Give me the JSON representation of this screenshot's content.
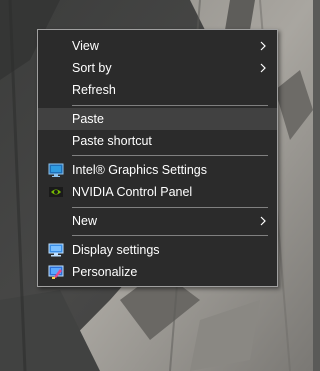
{
  "menu": {
    "items": [
      {
        "label": "View",
        "submenu": true
      },
      {
        "label": "Sort by",
        "submenu": true
      },
      {
        "label": "Refresh"
      },
      {
        "label": "Paste",
        "highlighted": true
      },
      {
        "label": "Paste shortcut"
      },
      {
        "label": "Intel® Graphics Settings",
        "icon": "intel-graphics-icon"
      },
      {
        "label": "NVIDIA Control Panel",
        "icon": "nvidia-icon"
      },
      {
        "label": "New",
        "submenu": true
      },
      {
        "label": "Display settings",
        "icon": "display-settings-icon"
      },
      {
        "label": "Personalize",
        "icon": "personalize-icon"
      }
    ]
  },
  "colors": {
    "menu_bg": "#2b2b2b",
    "highlight_bg": "#414141",
    "text": "#ffffff",
    "separator": "#808080",
    "border": "#a0a0a0"
  }
}
